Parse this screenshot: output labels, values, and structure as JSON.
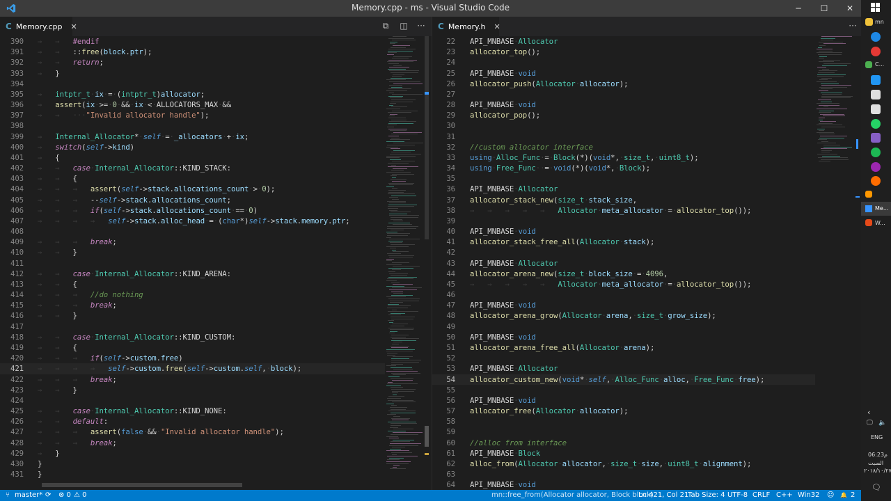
{
  "window": {
    "title": "Memory.cpp - ms - Visual Studio Code",
    "min_glyph": "─",
    "max_glyph": "☐",
    "close_glyph": "✕"
  },
  "left_editor": {
    "tab": {
      "label": "Memory.cpp",
      "icon": "C",
      "close": "✕"
    },
    "tools": {
      "split": "⧉",
      "layout": "◫",
      "more": "···"
    },
    "current_line": 421,
    "lines": [
      {
        "n": "390",
        "t": "→   →   #endif"
      },
      {
        "n": "391",
        "t": "→   →   ::free(block.ptr);"
      },
      {
        "n": "392",
        "t": "→   →   return;"
      },
      {
        "n": "393",
        "t": "→   }"
      },
      {
        "n": "394",
        "t": ""
      },
      {
        "n": "395",
        "t": "→   intptr_t·ix·=·(intptr_t)allocator;"
      },
      {
        "n": "396",
        "t": "→   assert(ix·>=·0·&&·ix·<·ALLOCATORS_MAX·&&"
      },
      {
        "n": "397",
        "t": "→   →   ···\"Invalid·allocator·handle\");"
      },
      {
        "n": "398",
        "t": ""
      },
      {
        "n": "399",
        "t": "→   Internal_Allocator*·self·=·_allocators·+·ix;"
      },
      {
        "n": "400",
        "t": "→   switch(self->kind)"
      },
      {
        "n": "401",
        "t": "→   {"
      },
      {
        "n": "402",
        "t": "→   →   case·Internal_Allocator::KIND_STACK:"
      },
      {
        "n": "403",
        "t": "→   →   {"
      },
      {
        "n": "404",
        "t": "→   →   →   assert(self->stack.allocations_count·>·0);"
      },
      {
        "n": "405",
        "t": "→   →   →   --self->stack.allocations_count;"
      },
      {
        "n": "406",
        "t": "→   →   →   if(self->stack.allocations_count·==·0)"
      },
      {
        "n": "407",
        "t": "→   →   →   →   self->stack.alloc_head·=·(char*)self->stack.memory.ptr;"
      },
      {
        "n": "408",
        "t": ""
      },
      {
        "n": "409",
        "t": "→   →   →   break;"
      },
      {
        "n": "410",
        "t": "→   →   }"
      },
      {
        "n": "411",
        "t": ""
      },
      {
        "n": "412",
        "t": "→   →   case·Internal_Allocator::KIND_ARENA:"
      },
      {
        "n": "413",
        "t": "→   →   {"
      },
      {
        "n": "414",
        "t": "→   →   →   //do·nothing"
      },
      {
        "n": "415",
        "t": "→   →   →   break;"
      },
      {
        "n": "416",
        "t": "→   →   }"
      },
      {
        "n": "417",
        "t": ""
      },
      {
        "n": "418",
        "t": "→   →   case·Internal_Allocator::KIND_CUSTOM:"
      },
      {
        "n": "419",
        "t": "→   →   {"
      },
      {
        "n": "420",
        "t": "→   →   →   if(self->custom.free)"
      },
      {
        "n": "421",
        "t": "→   →   →   →   self->custom.free(self->custom.self,·block);"
      },
      {
        "n": "422",
        "t": "→   →   →   break;"
      },
      {
        "n": "423",
        "t": "→   →   }"
      },
      {
        "n": "424",
        "t": ""
      },
      {
        "n": "425",
        "t": "→   →   case·Internal_Allocator::KIND_NONE:"
      },
      {
        "n": "426",
        "t": "→   →   default:"
      },
      {
        "n": "427",
        "t": "→   →   →   assert(false·&&·\"Invalid·allocator·handle\");"
      },
      {
        "n": "428",
        "t": "→   →   →   break;"
      },
      {
        "n": "429",
        "t": "→   }"
      },
      {
        "n": "430",
        "t": "}"
      },
      {
        "n": "431",
        "t": "}"
      }
    ]
  },
  "right_editor": {
    "tab": {
      "label": "Memory.h",
      "icon": "C",
      "close": "✕"
    },
    "tools": {
      "more": "···"
    },
    "current_line": 54,
    "lines": [
      {
        "n": "22",
        "t": "API_MNBASE·Allocator"
      },
      {
        "n": "23",
        "t": "allocator_top();"
      },
      {
        "n": "24",
        "t": ""
      },
      {
        "n": "25",
        "t": "API_MNBASE·void"
      },
      {
        "n": "26",
        "t": "allocator_push(Allocator·allocator);"
      },
      {
        "n": "27",
        "t": ""
      },
      {
        "n": "28",
        "t": "API_MNBASE·void"
      },
      {
        "n": "29",
        "t": "allocator_pop();"
      },
      {
        "n": "30",
        "t": ""
      },
      {
        "n": "31",
        "t": ""
      },
      {
        "n": "32",
        "t": "//custom·allocator·interface"
      },
      {
        "n": "33",
        "t": "using·Alloc_Func·=·Block(*)(void*,·size_t,·uint8_t);"
      },
      {
        "n": "34",
        "t": "using·Free_Func··=·void(*)(void*,·Block);"
      },
      {
        "n": "35",
        "t": ""
      },
      {
        "n": "36",
        "t": "API_MNBASE·Allocator"
      },
      {
        "n": "37",
        "t": "allocator_stack_new(size_t·stack_size,"
      },
      {
        "n": "38",
        "t": "→   →   →   →   →   Allocator·meta_allocator·=·allocator_top());"
      },
      {
        "n": "39",
        "t": ""
      },
      {
        "n": "40",
        "t": "API_MNBASE·void"
      },
      {
        "n": "41",
        "t": "allocator_stack_free_all(Allocator·stack);"
      },
      {
        "n": "42",
        "t": ""
      },
      {
        "n": "43",
        "t": "API_MNBASE·Allocator"
      },
      {
        "n": "44",
        "t": "allocator_arena_new(size_t·block_size·=·4096,"
      },
      {
        "n": "45",
        "t": "→   →   →   →   →   Allocator·meta_allocator·=·allocator_top());"
      },
      {
        "n": "46",
        "t": ""
      },
      {
        "n": "47",
        "t": "API_MNBASE·void"
      },
      {
        "n": "48",
        "t": "allocator_arena_grow(Allocator·arena,·size_t·grow_size);"
      },
      {
        "n": "49",
        "t": ""
      },
      {
        "n": "50",
        "t": "API_MNBASE·void"
      },
      {
        "n": "51",
        "t": "allocator_arena_free_all(Allocator·arena);"
      },
      {
        "n": "52",
        "t": ""
      },
      {
        "n": "53",
        "t": "API_MNBASE·Allocator"
      },
      {
        "n": "54",
        "t": "allocator_custom_new(void*·self,·Alloc_Func·alloc,·Free_Func·free);"
      },
      {
        "n": "55",
        "t": ""
      },
      {
        "n": "56",
        "t": "API_MNBASE·void"
      },
      {
        "n": "57",
        "t": "allocator_free(Allocator·allocator);"
      },
      {
        "n": "58",
        "t": ""
      },
      {
        "n": "59",
        "t": ""
      },
      {
        "n": "60",
        "t": "//alloc·from·interface"
      },
      {
        "n": "61",
        "t": "API_MNBASE·Block"
      },
      {
        "n": "62",
        "t": "alloc_from(Allocator·allocator,·size_t·size,·uint8_t·alignment);"
      },
      {
        "n": "63",
        "t": ""
      },
      {
        "n": "64",
        "t": "API_MNBASE·void"
      }
    ]
  },
  "statusbar": {
    "branch": "master*",
    "sync": "⟳",
    "errors": "⊗ 0",
    "warnings": "⚠ 0",
    "context": "mn::free_from(Allocator allocator, Block block)",
    "position": "Ln 421, Col 21",
    "tab_size": "Tab Size: 4",
    "encoding": "UTF-8",
    "eol": "CRLF",
    "language": "C++",
    "platform": "Win32",
    "smiley": "☺",
    "bell": "🔔",
    "notifications": "2"
  },
  "taskbar": {
    "labels": [
      "mn",
      "C...",
      "Me...",
      "W..."
    ],
    "lang": "ENG",
    "time": "06:23",
    "ampm": "م",
    "day": "السبت",
    "date": "٢٠١٨/١٠/٢٧"
  },
  "colors": {
    "accent": "#007acc",
    "titlebar": "#3c3c3c",
    "editor_bg": "#1e1e1e"
  }
}
